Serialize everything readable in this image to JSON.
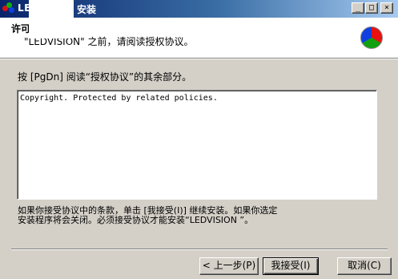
{
  "window": {
    "title_prefix": "LED",
    "title_suffix": "安装",
    "minimize_label": "_",
    "maximize_label": "□",
    "close_label": "×"
  },
  "header": {
    "title": "许可",
    "subtitle": "\"LEDVISION\" 之前，请阅读授权协议。"
  },
  "body": {
    "instruction": "按 [PgDn] 阅读“授权协议”的其余部分。",
    "license_text": "Copyright. Protected by related policies.",
    "notice_line1": "如果你接受协议中的条款，单击 [我接受(I)] 继续安装。如果你选定",
    "notice_line1_end": ")],",
    "notice_line2": "安装程序将会关闭。必须接受协议才能安装“LEDVISION ”。"
  },
  "buttons": {
    "back": "< 上一步(P)",
    "accept": "我接受(I)",
    "cancel": "取消(C)"
  },
  "colors": {
    "titlebar_start": "#0a246a",
    "titlebar_end": "#a6caf0",
    "dialog_bg": "#d4d0c8"
  }
}
